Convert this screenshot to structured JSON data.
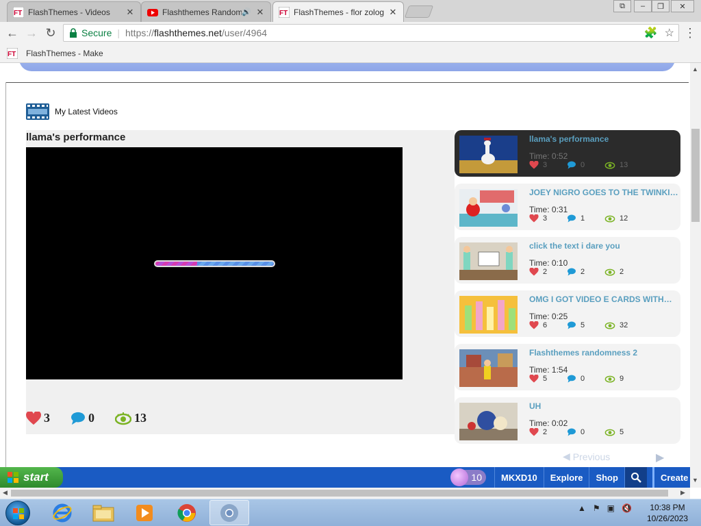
{
  "browser": {
    "tabs": [
      {
        "title": "FlashThemes - Videos",
        "active": false
      },
      {
        "title": "Flashthemes Random",
        "active": false,
        "audio": true
      },
      {
        "title": "FlashThemes - flor zolog",
        "active": true
      }
    ],
    "window_controls": {
      "user": "⧉",
      "minimize": "–",
      "restore": "❐",
      "close": "✕"
    },
    "secure_label": "Secure",
    "url_scheme": "https://",
    "url_host": "flashthemes.net",
    "url_path": "/user/4964",
    "bookmark": "FlashThemes - Make"
  },
  "section": {
    "title": "My Latest Videos"
  },
  "player": {
    "title": "llama's performance",
    "load_progress": 0.35,
    "likes": "3",
    "comments": "0",
    "views": "13"
  },
  "videos": [
    {
      "title": "llama's performance",
      "time": "Time: 0:52",
      "likes": "3",
      "comments": "0",
      "views": "13",
      "selected": true
    },
    {
      "title": "JOEY NIGRO GOES TO THE TWINKIES FACTORY",
      "time": "Time: 0:31",
      "likes": "3",
      "comments": "1",
      "views": "12"
    },
    {
      "title": "click the text i dare you",
      "time": "Time: 0:10",
      "likes": "2",
      "comments": "2",
      "views": "2"
    },
    {
      "title": "OMG I GOT VIDEO E CARDS WITHOUT",
      "time": "Time: 0:25",
      "likes": "6",
      "comments": "5",
      "views": "32"
    },
    {
      "title": "Flashthemes randomness 2",
      "time": "Time: 1:54",
      "likes": "5",
      "comments": "0",
      "views": "9"
    },
    {
      "title": "UH",
      "time": "Time: 0:02",
      "likes": "2",
      "comments": "0",
      "views": "5"
    }
  ],
  "pager": {
    "previous": "Previous"
  },
  "sitebar": {
    "start": "start",
    "coins": "10",
    "links": [
      "MKXD10",
      "Explore",
      "Shop"
    ],
    "create": "Create"
  },
  "taskbar": {
    "time": "10:38 PM",
    "date": "10/26/2023"
  },
  "colors": {
    "accent_blue": "#1a5bc3",
    "title_link": "#5a9fbf",
    "heart": "#e0484f",
    "comment": "#1f9ad6",
    "eye": "#7bb324"
  }
}
